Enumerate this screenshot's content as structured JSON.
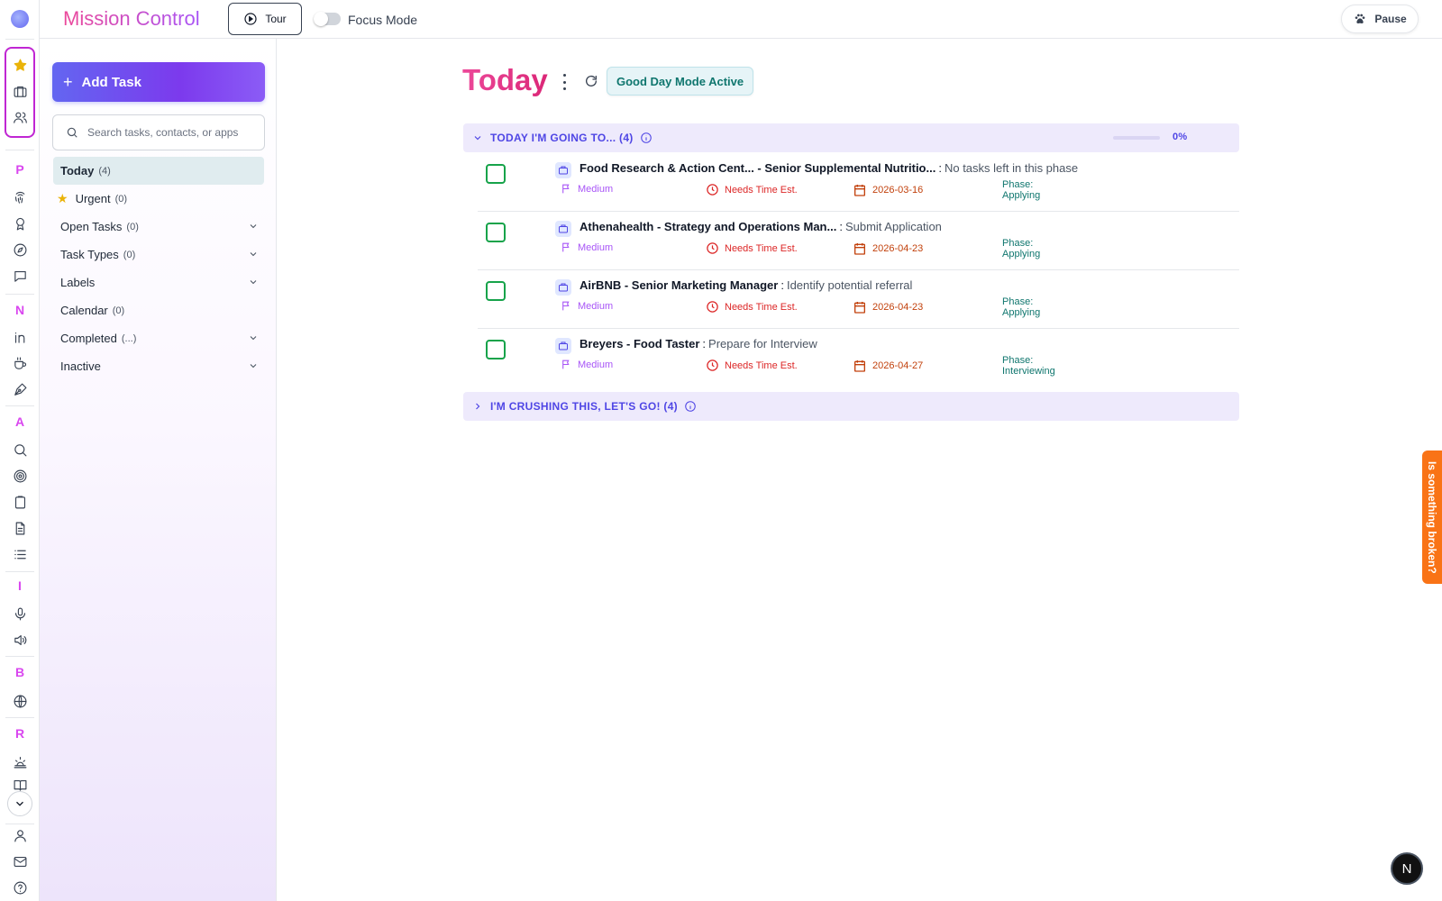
{
  "header": {
    "app_title": "Mission Control",
    "tour_label": "Tour",
    "focus_mode_label": "Focus Mode",
    "focus_mode_on": false,
    "pause_label": "Pause"
  },
  "rail": {
    "letters": [
      "P",
      "N",
      "A",
      "I",
      "B",
      "R"
    ],
    "icons": [
      "star-icon",
      "briefcase-icon",
      "users-icon",
      "fingerprint-icon",
      "award-icon",
      "compass-icon",
      "message-icon",
      "linkedin-icon",
      "coffee-icon",
      "pen-icon",
      "search-icon",
      "target-icon",
      "clipboard-icon",
      "document-icon",
      "list-icon",
      "mic-icon",
      "speaker-icon",
      "globe-icon",
      "sunrise-icon",
      "book-icon",
      "chevron-down-icon",
      "user-icon",
      "mail-icon",
      "help-icon"
    ]
  },
  "sidebar": {
    "add_task_label": "Add Task",
    "search_placeholder": "Search tasks, contacts, or apps",
    "items": [
      {
        "label": "Today",
        "count": "(4)"
      },
      {
        "label": "Urgent",
        "count": "(0)"
      },
      {
        "label": "Open Tasks",
        "count": "(0)"
      },
      {
        "label": "Task Types",
        "count": "(0)"
      },
      {
        "label": "Labels",
        "count": ""
      },
      {
        "label": "Calendar",
        "count": "(0)"
      },
      {
        "label": "Completed",
        "count": "(...)"
      },
      {
        "label": "Inactive",
        "count": ""
      }
    ]
  },
  "main": {
    "title": "Today",
    "good_day_badge": "Good Day Mode Active",
    "sections": [
      {
        "label": "TODAY I'M GOING TO... (4)",
        "progress_percent": 0,
        "progress_label": "0%",
        "expanded": true
      },
      {
        "label": "I'M CRUSHING THIS, LET'S GO! (4)",
        "expanded": false
      }
    ],
    "tasks": [
      {
        "name": "Food Research & Action Cent... - Senior Supplemental Nutritio...",
        "separator": ":",
        "step": "No tasks left in this phase",
        "priority": "Medium",
        "time": "Needs Time Est.",
        "date": "2026-03-16",
        "phase_label": "Phase:",
        "phase": "Applying"
      },
      {
        "name": "Athenahealth - Strategy and Operations Man...",
        "separator": ":",
        "step": "Submit Application",
        "priority": "Medium",
        "time": "Needs Time Est.",
        "date": "2026-04-23",
        "phase_label": "Phase:",
        "phase": "Applying"
      },
      {
        "name": "AirBNB - Senior Marketing Manager",
        "separator": ":",
        "step": "Identify potential referral",
        "priority": "Medium",
        "time": "Needs Time Est.",
        "date": "2026-04-23",
        "phase_label": "Phase:",
        "phase": "Applying"
      },
      {
        "name": "Breyers - Food Taster",
        "separator": ":",
        "step": "Prepare for Interview",
        "priority": "Medium",
        "time": "Needs Time Est.",
        "date": "2026-04-27",
        "phase_label": "Phase:",
        "phase": "Interviewing"
      }
    ]
  },
  "feedback_tab": "Is something broken?",
  "corner_badge": "N",
  "colors": {
    "accent": "#6366f1",
    "brand_pink": "#ec4899",
    "checkbox": "#16a34a",
    "priority": "#a855f7",
    "time_warning": "#dc2626",
    "date": "#c2410c",
    "phase": "#0f766e",
    "feedback": "#f97316"
  }
}
